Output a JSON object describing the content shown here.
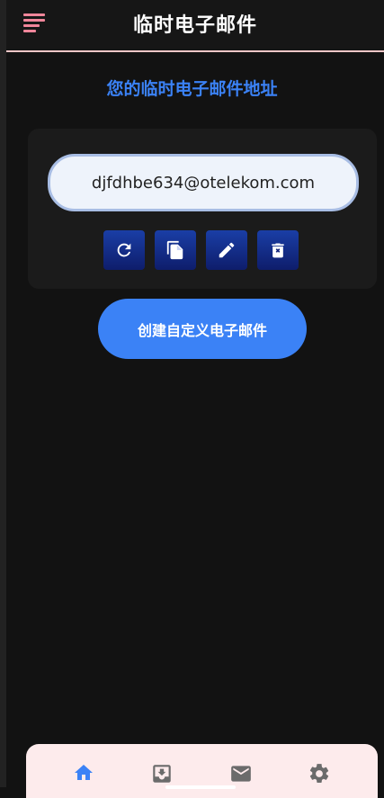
{
  "header": {
    "title": "临时电子邮件",
    "menu_icon": "hamburger-menu-icon",
    "accent_color": "#f0869a"
  },
  "main": {
    "section_title": "您的临时电子邮件地址",
    "email": "djfdhbe634@otelekom.com",
    "actions": [
      {
        "name": "refresh",
        "icon": "refresh-icon"
      },
      {
        "name": "copy",
        "icon": "copy-icon"
      },
      {
        "name": "edit",
        "icon": "edit-icon"
      },
      {
        "name": "delete",
        "icon": "delete-icon"
      }
    ],
    "create_button_label": "创建自定义电子邮件",
    "accent_color": "#3b82f6"
  },
  "bottom_nav": {
    "items": [
      {
        "name": "home",
        "icon": "home-icon",
        "active": true,
        "color": "#3b82f6"
      },
      {
        "name": "inbox",
        "icon": "inbox-icon",
        "active": false,
        "color": "#6b6b6b"
      },
      {
        "name": "mail",
        "icon": "mail-icon",
        "active": false,
        "color": "#6b6b6b"
      },
      {
        "name": "settings",
        "icon": "settings-icon",
        "active": false,
        "color": "#6b6b6b"
      }
    ]
  }
}
